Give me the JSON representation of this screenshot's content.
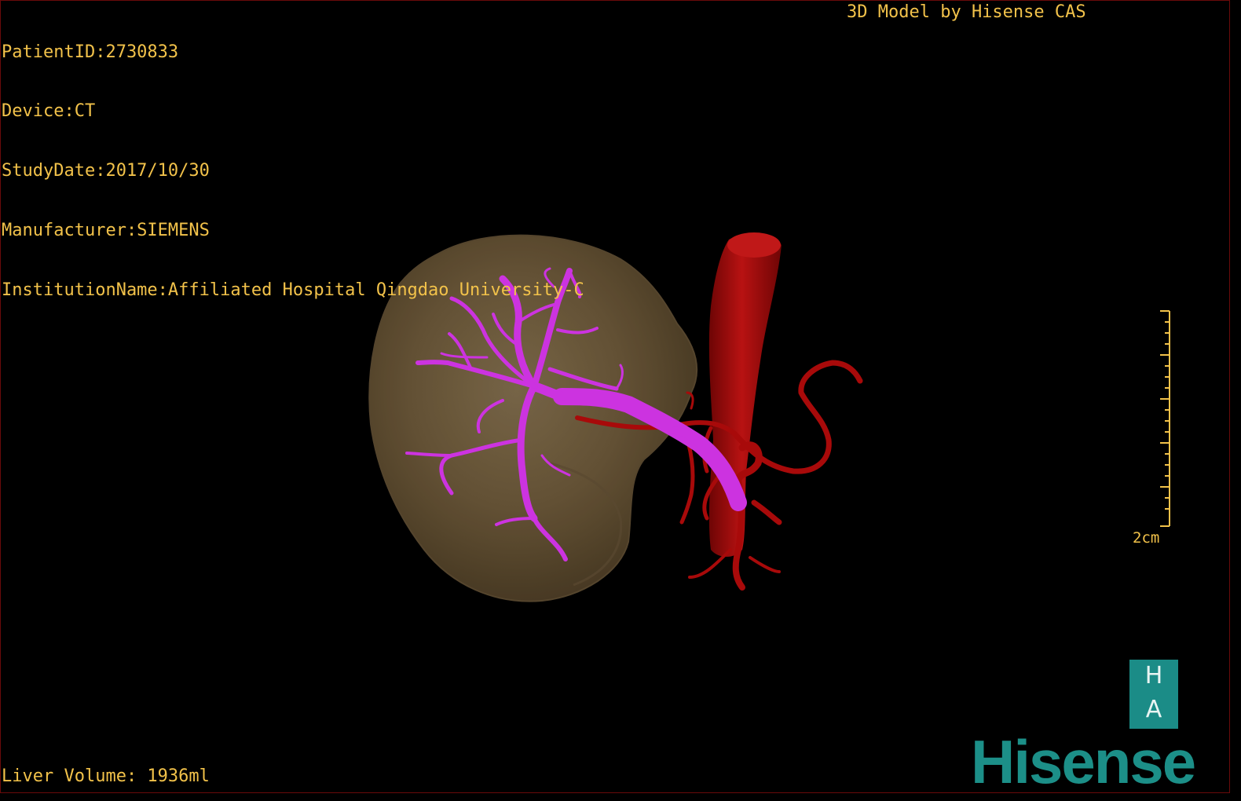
{
  "overlay": {
    "patient_id": "PatientID:2730833",
    "device": "Device:CT",
    "study_date": "StudyDate:2017/10/30",
    "manufacturer": "Manufacturer:SIEMENS",
    "institution": "InstitutionName:Affiliated Hospital Qingdao University-C",
    "model_credit": "3D Model by Hisense CAS",
    "liver_volume": "Liver Volume: 1936ml"
  },
  "scale_bar": {
    "label": "2cm"
  },
  "badge": {
    "top_letter": "H",
    "bottom_letter": "A"
  },
  "logo": {
    "text": "Hisense"
  },
  "colors": {
    "overlay_text": "#f2c24a",
    "liver": "#6e5a3c",
    "portal_vein": "#cc33e0",
    "arteries": "#a80a0a",
    "brand": "#1c8f88"
  }
}
